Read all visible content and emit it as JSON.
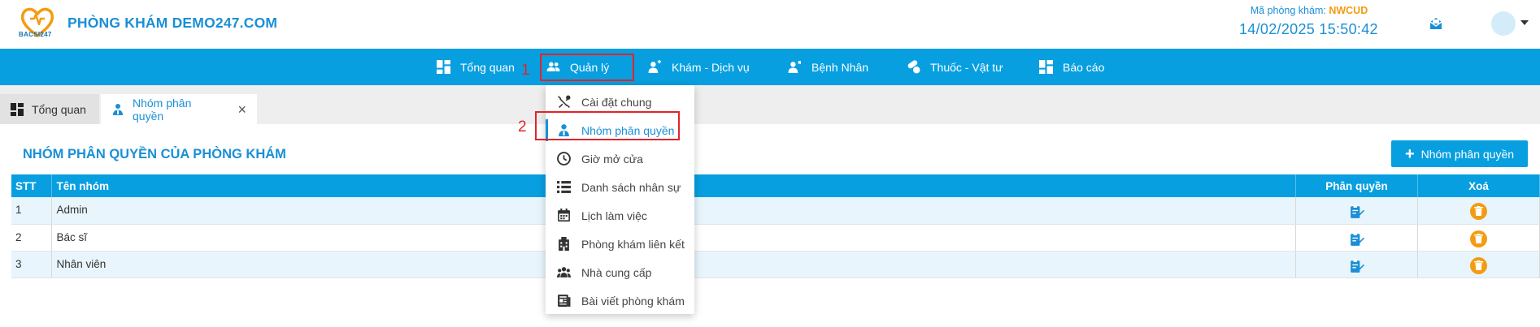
{
  "header": {
    "logo_text": "BACSI247",
    "clinic_name": "PHÒNG KHÁM DEMO247.COM",
    "clinic_code_label": "Mã phòng khám:",
    "clinic_code": "NWCUD",
    "datetime": "14/02/2025 15:50:42"
  },
  "nav": {
    "items": [
      {
        "label": "Tổng quan",
        "icon": "dashboard-icon"
      },
      {
        "label": "Quản lý",
        "icon": "users-icon"
      },
      {
        "label": "Khám - Dịch vụ",
        "icon": "medical-service-icon"
      },
      {
        "label": "Bệnh Nhân",
        "icon": "patient-icon"
      },
      {
        "label": "Thuốc - Vật tư",
        "icon": "pills-icon"
      },
      {
        "label": "Báo cáo",
        "icon": "report-icon"
      }
    ],
    "active": "Quản lý"
  },
  "annotations": {
    "step1": "1",
    "step2": "2"
  },
  "tabs": [
    {
      "label": "Tổng quan",
      "icon": "dashboard-icon"
    },
    {
      "label": "Nhóm phân quyền",
      "icon": "user-role-icon"
    }
  ],
  "dropdown": {
    "items": [
      {
        "label": "Cài đặt chung",
        "icon": "tools-icon"
      },
      {
        "label": "Nhóm phân quyền",
        "icon": "user-role-icon"
      },
      {
        "label": "Giờ mở cửa",
        "icon": "clock-icon"
      },
      {
        "label": "Danh sách nhân sự",
        "icon": "list-icon"
      },
      {
        "label": "Lịch làm việc",
        "icon": "calendar-icon"
      },
      {
        "label": "Phòng khám liên kết",
        "icon": "building-icon"
      },
      {
        "label": "Nhà cung cấp",
        "icon": "supplier-icon"
      },
      {
        "label": "Bài viết phòng khám",
        "icon": "article-icon"
      }
    ],
    "active": "Nhóm phân quyền"
  },
  "main": {
    "title": "NHÓM PHÂN QUYỀN CỦA PHÒNG KHÁM",
    "add_button": "Nhóm phân quyền",
    "table": {
      "headers": {
        "stt": "STT",
        "name": "Tên nhóm",
        "permission": "Phân quyền",
        "delete": "Xoá"
      },
      "rows": [
        {
          "stt": "1",
          "name": "Admin"
        },
        {
          "stt": "2",
          "name": "Bác sĩ"
        },
        {
          "stt": "3",
          "name": "Nhân viên"
        }
      ]
    }
  },
  "colors": {
    "primary": "#079fe0",
    "title_blue": "#1a8fd6",
    "accent_orange": "#f39c12",
    "highlight_red": "#e0242b",
    "row_stripe": "#e8f5fc"
  }
}
